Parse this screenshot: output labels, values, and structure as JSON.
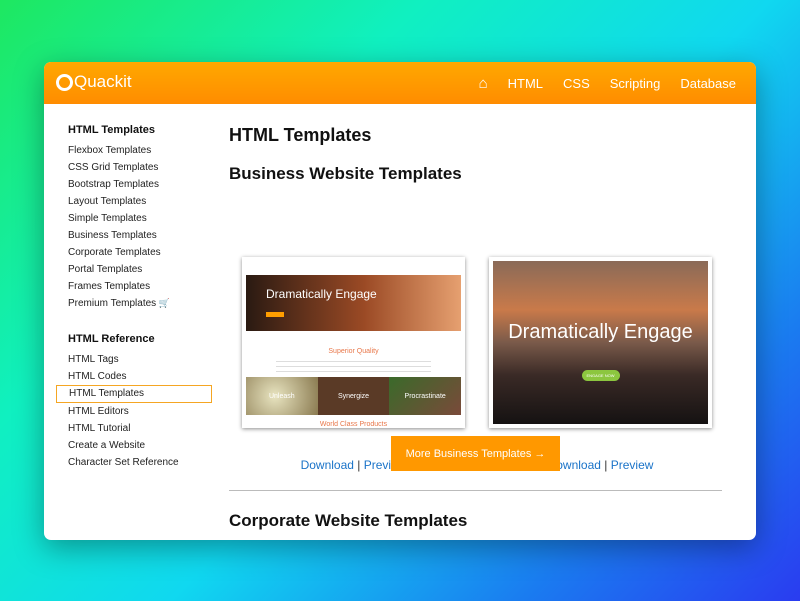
{
  "header": {
    "logo": "Quackit",
    "nav": [
      {
        "icon": "home-icon",
        "label": "⌂"
      },
      {
        "label": "HTML"
      },
      {
        "label": "CSS"
      },
      {
        "label": "Scripting"
      },
      {
        "label": "Database"
      }
    ]
  },
  "sidebar": {
    "sections": [
      {
        "title": "HTML Templates",
        "items": [
          "Flexbox Templates",
          "CSS Grid Templates",
          "Bootstrap Templates",
          "Layout Templates",
          "Simple Templates",
          "Business Templates",
          "Corporate Templates",
          "Portal Templates",
          "Frames Templates",
          "Premium Templates"
        ]
      },
      {
        "title": "HTML Reference",
        "items": [
          "HTML Tags",
          "HTML Codes",
          "HTML Templates",
          "HTML Editors",
          "HTML Tutorial",
          "Create a Website",
          "Character Set Reference"
        ],
        "selected": "HTML Templates"
      }
    ],
    "premium_icon": "shopping-cart-icon"
  },
  "main": {
    "title": "HTML Templates",
    "section1": "Business Website Templates",
    "templates": [
      {
        "hero": "Dramatically Engage",
        "heading": "Superior Quality",
        "tiles": [
          "Unleash",
          "Synergize",
          "Procrastinate"
        ],
        "footer": "World Class Products",
        "download": "Download",
        "preview": "Preview"
      },
      {
        "hero": "Dramatically Engage",
        "button": "ENGAGE NOW",
        "download": "Download",
        "preview": "Preview"
      }
    ],
    "separator": "|",
    "more_button": "More Business Templates →",
    "section2": "Corporate Website Templates"
  },
  "colors": {
    "brand": "#ff9800",
    "link": "#1a73c8"
  }
}
